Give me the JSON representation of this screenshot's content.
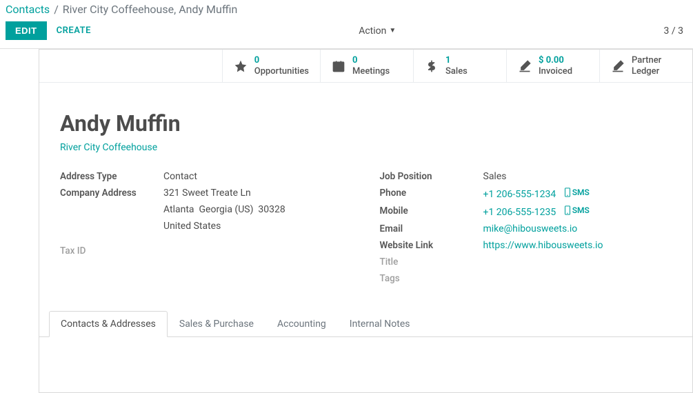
{
  "breadcrumb": {
    "root": "Contacts",
    "sep": "/",
    "current": "River City Coffeehouse, Andy Muffin"
  },
  "toolbar": {
    "edit": "EDIT",
    "create": "CREATE",
    "action": "Action",
    "pager": "3 / 3"
  },
  "stats": [
    {
      "number": "0",
      "label": "Opportunities",
      "icon": "star"
    },
    {
      "number": "0",
      "label": "Meetings",
      "icon": "calendar"
    },
    {
      "number": "1",
      "label": "Sales",
      "icon": "dollar"
    },
    {
      "number": "$ 0.00",
      "label": "Invoiced",
      "icon": "edit"
    },
    {
      "number": "Partner",
      "label": "Ledger",
      "icon": "edit",
      "textcolor": "plain"
    }
  ],
  "contact": {
    "name": "Andy Muffin",
    "company": "River City Coffeehouse"
  },
  "left_fields": {
    "address_type_label": "Address Type",
    "address_type": "Contact",
    "company_address_label": "Company Address",
    "addr_street": "321 Sweet Treate Ln",
    "addr_city": "Atlanta",
    "addr_state": "Georgia (US)",
    "addr_zip": "30328",
    "addr_country": "United States",
    "tax_id_label": "Tax ID",
    "tax_id": ""
  },
  "right_fields": {
    "job_position_label": "Job Position",
    "job_position": "Sales",
    "phone_label": "Phone",
    "phone": "+1 206-555-1234",
    "mobile_label": "Mobile",
    "mobile": "+1 206-555-1235",
    "sms": "SMS",
    "email_label": "Email",
    "email": "mike@hibousweets.io",
    "website_label": "Website Link",
    "website": "https://www.hibousweets.io",
    "title_label": "Title",
    "tags_label": "Tags"
  },
  "tabs": [
    "Contacts & Addresses",
    "Sales & Purchase",
    "Accounting",
    "Internal Notes"
  ]
}
